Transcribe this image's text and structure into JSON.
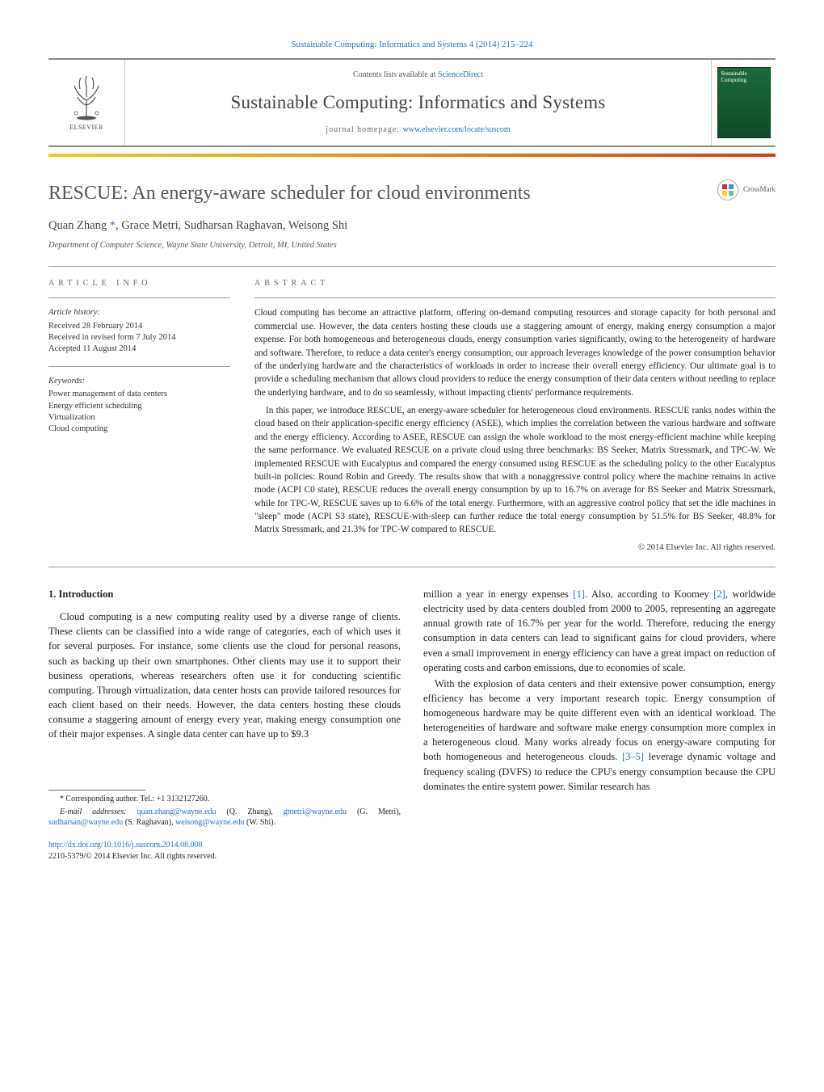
{
  "journal_ref": "Sustainable Computing: Informatics and Systems 4 (2014) 215–224",
  "contents_prefix": "Contents lists available at ",
  "contents_link": "ScienceDirect",
  "journal_title": "Sustainable Computing: Informatics and Systems",
  "homepage_prefix": "journal homepage: ",
  "homepage_link": "www.elsevier.com/locate/suscom",
  "publisher": "ELSEVIER",
  "cover_text": "Sustainable Computing",
  "crossmark_label": "CrossMark",
  "article_title": "RESCUE: An energy-aware scheduler for cloud environments",
  "authors_raw": "Quan Zhang*, Grace Metri, Sudharsan Raghavan, Weisong Shi",
  "authors": [
    {
      "name": "Quan Zhang",
      "corr": true
    },
    {
      "name": "Grace Metri",
      "corr": false
    },
    {
      "name": "Sudharsan Raghavan",
      "corr": false
    },
    {
      "name": "Weisong Shi",
      "corr": false
    }
  ],
  "affiliation": "Department of Computer Science, Wayne State University, Detroit, MI, United States",
  "info_heading": "ARTICLE INFO",
  "abstract_heading": "ABSTRACT",
  "history_label": "Article history:",
  "history": [
    "Received 28 February 2014",
    "Received in revised form 7 July 2014",
    "Accepted 11 August 2014"
  ],
  "keywords_label": "Keywords:",
  "keywords": [
    "Power management of data centers",
    "Energy efficient scheduling",
    "Virtualization",
    "Cloud computing"
  ],
  "abstract_paras": [
    "Cloud computing has become an attractive platform, offering on-demand computing resources and storage capacity for both personal and commercial use. However, the data centers hosting these clouds use a staggering amount of energy, making energy consumption a major expense. For both homogeneous and heterogeneous clouds, energy consumption varies significantly, owing to the heterogeneity of hardware and software. Therefore, to reduce a data center's energy consumption, our approach leverages knowledge of the power consumption behavior of the underlying hardware and the characteristics of workloads in order to increase their overall energy efficiency. Our ultimate goal is to provide a scheduling mechanism that allows cloud providers to reduce the energy consumption of their data centers without needing to replace the underlying hardware, and to do so seamlessly, without impacting clients' performance requirements.",
    "In this paper, we introduce RESCUE, an energy-aware scheduler for heterogeneous cloud environments. RESCUE ranks nodes within the cloud based on their application-specific energy efficiency (ASEE), which implies the correlation between the various hardware and software and the energy efficiency. According to ASEE, RESCUE can assign the whole workload to the most energy-efficient machine while keeping the same performance. We evaluated RESCUE on a private cloud using three benchmarks: BS Seeker, Matrix Stressmark, and TPC-W. We implemented RESCUE with Eucalyptus and compared the energy consumed using RESCUE as the scheduling policy to the other Eucalyptus built-in policies: Round Robin and Greedy. The results show that with a nonaggressive control policy where the machine remains in active mode (ACPI C0 state), RESCUE reduces the overall energy consumption by up to 16.7% on average for BS Seeker and Matrix Stressmark, while for TPC-W, RESCUE saves up to 6.6% of the total energy. Furthermore, with an aggressive control policy that set the idle machines in \"sleep\" mode (ACPI S3 state), RESCUE-with-sleep can further reduce the total energy consumption by 51.5% for BS Seeker, 48.8% for Matrix Stressmark, and 21.3% for TPC-W compared to RESCUE."
  ],
  "abstract_copyright": "© 2014 Elsevier Inc. All rights reserved.",
  "section1_title": "1. Introduction",
  "body_para1": "Cloud computing is a new computing reality used by a diverse range of clients. These clients can be classified into a wide range of categories, each of which uses it for several purposes. For instance, some clients use the cloud for personal reasons, such as backing up their own smartphones. Other clients may use it to support their business operations, whereas researchers often use it for conducting scientific computing. Through virtualization, data center hosts can provide tailored resources for each client based on their needs. However, the data centers hosting these clouds consume a staggering amount of energy every year, making energy consumption one of their major expenses. A single data center can have up to $9.3",
  "body_para2a": "million a year in energy expenses ",
  "body_cite1": "[1]",
  "body_para2b": ". Also, according to Koomey ",
  "body_cite2": "[2]",
  "body_para2c": ", worldwide electricity used by data centers doubled from 2000 to 2005, representing an aggregate annual growth rate of 16.7% per year for the world. Therefore, reducing the energy consumption in data centers can lead to significant gains for cloud providers, where even a small improvement in energy efficiency can have a great impact on reduction of operating costs and carbon emissions, due to economies of scale.",
  "body_para3a": "With the explosion of data centers and their extensive power consumption, energy efficiency has become a very important research topic. Energy consumption of homogeneous hardware may be quite different even with an identical workload. The heterogeneities of hardware and software make energy consumption more complex in a heterogeneous cloud. Many works already focus on energy-aware computing for both homogeneous and heterogeneous clouds. ",
  "body_cite3": "[3–5]",
  "body_para3b": " leverage dynamic voltage and frequency scaling (DVFS) to reduce the CPU's energy consumption because the CPU dominates the entire system power. Similar research has",
  "footnote_corr": "* Corresponding author. Tel.: +1 3132127260.",
  "footnote_email_label": "E-mail addresses: ",
  "emails": [
    {
      "addr": "quan.zhang@wayne.edu",
      "who": "(Q. Zhang)"
    },
    {
      "addr": "gmetri@wayne.edu",
      "who": "(G. Metri)"
    },
    {
      "addr": "sudharsan@wayne.edu",
      "who": "(S. Raghavan)"
    },
    {
      "addr": "weisong@wayne.edu",
      "who": "(W. Shi)"
    }
  ],
  "doi_link": "http://dx.doi.org/10.1016/j.suscom.2014.08.008",
  "issn_line": "2210-5379/© 2014 Elsevier Inc. All rights reserved."
}
